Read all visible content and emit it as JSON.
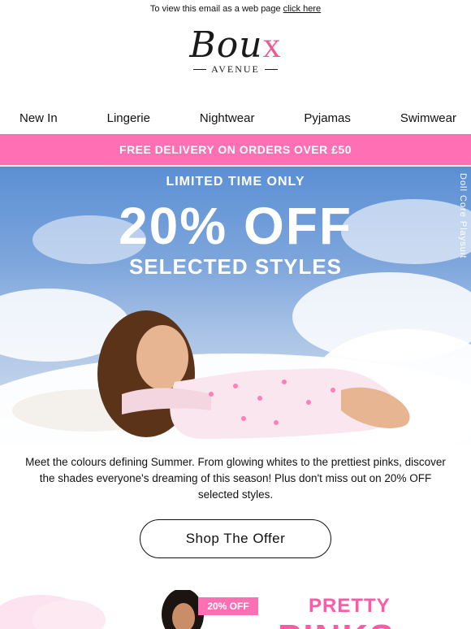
{
  "webview": {
    "text": "To view this email as a web page",
    "link": "click here"
  },
  "logo": {
    "brand_main": "Bou",
    "brand_x": "x",
    "brand_sub": "AVENUE"
  },
  "nav": {
    "items": [
      {
        "label": "New In"
      },
      {
        "label": "Lingerie"
      },
      {
        "label": "Nightwear"
      },
      {
        "label": "Pyjamas"
      },
      {
        "label": "Swimwear"
      }
    ]
  },
  "promo_bar": {
    "text": "FREE DELIVERY ON ORDERS OVER £50"
  },
  "hero": {
    "line1": "LIMITED TIME ONLY",
    "line2": "20% OFF",
    "line3": "SELECTED STYLES",
    "side_caption": "Doll Core Playsuit"
  },
  "description": {
    "text": "Meet the colours defining Summer. From glowing whites to the prettiest pinks, discover the shades everyone's dreaming of this season! Plus don't miss out on 20% OFF selected styles."
  },
  "cta": {
    "label": "Shop The Offer"
  },
  "teaser": {
    "badge": "20% OFF",
    "heading1": "PRETTY",
    "heading2": "PINKS"
  },
  "colors": {
    "accent_pink": "#ff6fb4",
    "heading_pink": "#ff5aa8",
    "text": "#111111"
  }
}
